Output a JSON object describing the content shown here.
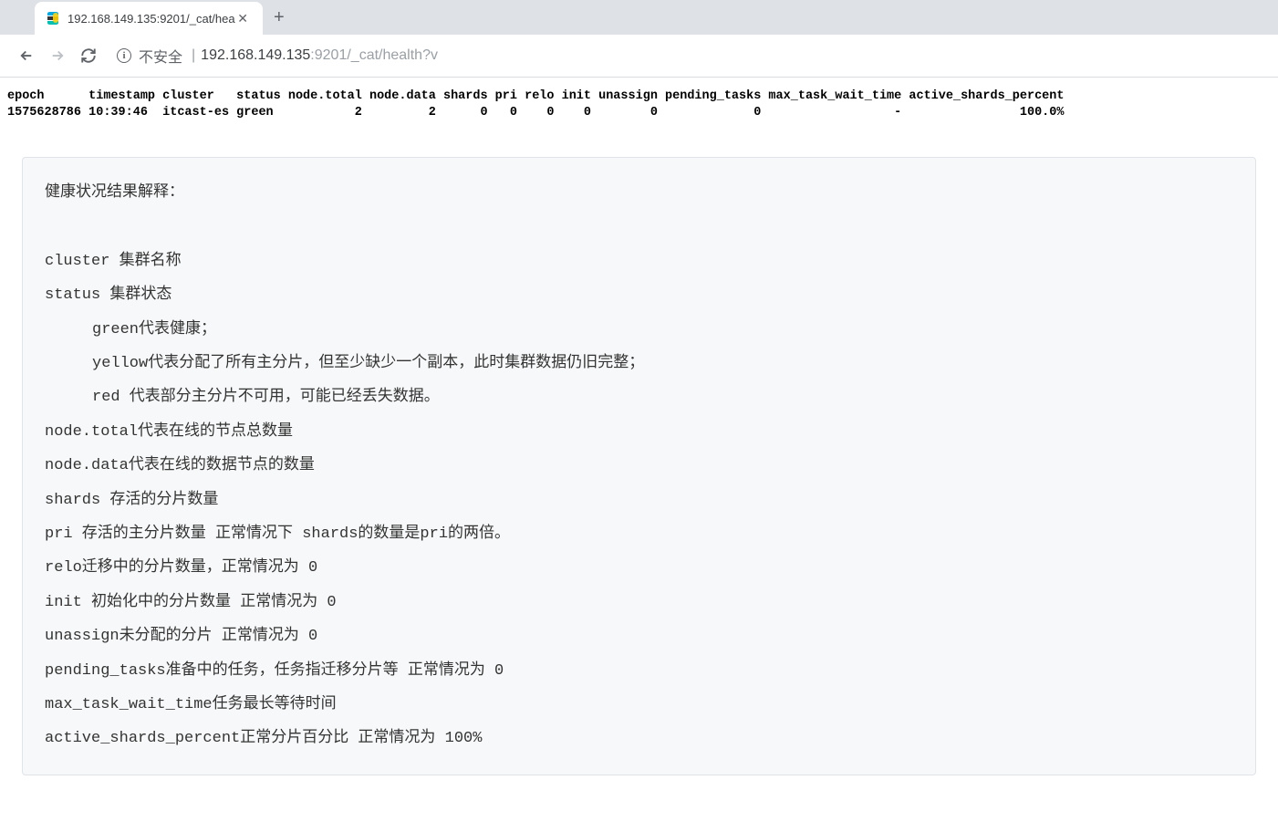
{
  "browser": {
    "tab_title": "192.168.149.135:9201/_cat/hea",
    "insecure_label": "不安全",
    "url_host": "192.168.149.135",
    "url_port": ":9201",
    "url_path": "/_cat/health?v"
  },
  "cat_output": {
    "header": "epoch      timestamp cluster   status node.total node.data shards pri relo init unassign pending_tasks max_task_wait_time active_shards_percent",
    "row": "1575628786 10:39:46  itcast-es green           2         2      0   0    0    0        0             0                  -                100.0%"
  },
  "doc": {
    "title": "健康状况结果解释：",
    "lines": [
      {
        "text": "cluster 集群名称",
        "indent": false
      },
      {
        "text": "status 集群状态",
        "indent": false
      },
      {
        "text": "green代表健康；",
        "indent": true
      },
      {
        "text": "yellow代表分配了所有主分片，但至少缺少一个副本，此时集群数据仍旧完整；",
        "indent": true
      },
      {
        "text": "red 代表部分主分片不可用，可能已经丢失数据。",
        "indent": true
      },
      {
        "text": "node.total代表在线的节点总数量",
        "indent": false
      },
      {
        "text": "node.data代表在线的数据节点的数量",
        "indent": false
      },
      {
        "text": "shards 存活的分片数量",
        "indent": false
      },
      {
        "text": "pri 存活的主分片数量 正常情况下 shards的数量是pri的两倍。",
        "indent": false
      },
      {
        "text": "relo迁移中的分片数量，正常情况为 0",
        "indent": false
      },
      {
        "text": "init 初始化中的分片数量 正常情况为 0",
        "indent": false
      },
      {
        "text": "unassign未分配的分片 正常情况为 0",
        "indent": false
      },
      {
        "text": "pending_tasks准备中的任务，任务指迁移分片等 正常情况为 0",
        "indent": false
      },
      {
        "text": "max_task_wait_time任务最长等待时间",
        "indent": false
      },
      {
        "text": "active_shards_percent正常分片百分比 正常情况为 100%",
        "indent": false
      }
    ]
  }
}
